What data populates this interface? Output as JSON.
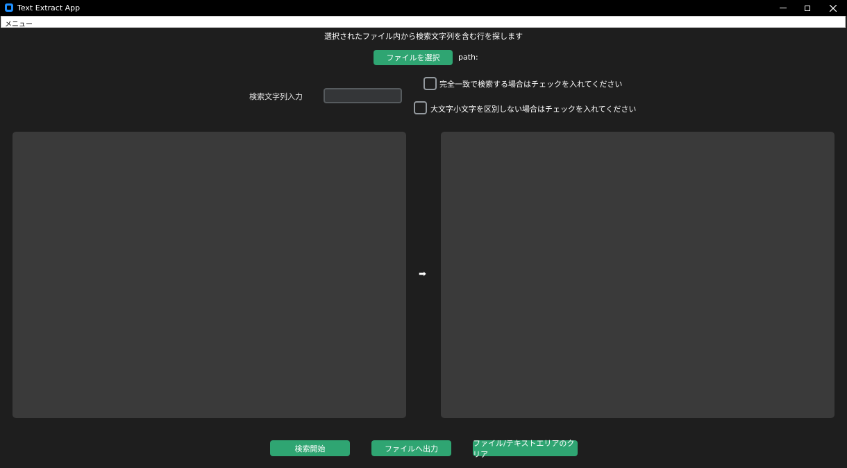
{
  "window": {
    "title": "Text Extract App",
    "app_icon": "app-icon",
    "controls": {
      "minimize_icon": "minimize-icon",
      "maximize_icon": "maximize-icon",
      "close_icon": "close-icon"
    }
  },
  "menubar": {
    "items": [
      {
        "label": "メニュー"
      }
    ]
  },
  "main": {
    "instruction": "選択されたファイル内から検索文字列を含む行を探します",
    "select_file_button": "ファイルを選択",
    "path_label": "path:",
    "search_label": "検索文字列入力",
    "search_value": "",
    "exact_match_label": "完全一致で検索する場合はチェックを入れてください",
    "exact_match_checked": false,
    "ignore_case_label": "大文字小文字を区別しない場合はチェックを入れてください",
    "ignore_case_checked": false,
    "input_text": "",
    "output_text": "",
    "arrow": "➡"
  },
  "actions": {
    "search_button": "検索開始",
    "output_button": "ファイルへ出力",
    "clear_button": "ファイル/テキストエリアのクリア"
  },
  "colors": {
    "background": "#1e1e1e",
    "titlebar": "#000000",
    "accent": "#2fa572",
    "textarea": "#3a3a3a"
  }
}
